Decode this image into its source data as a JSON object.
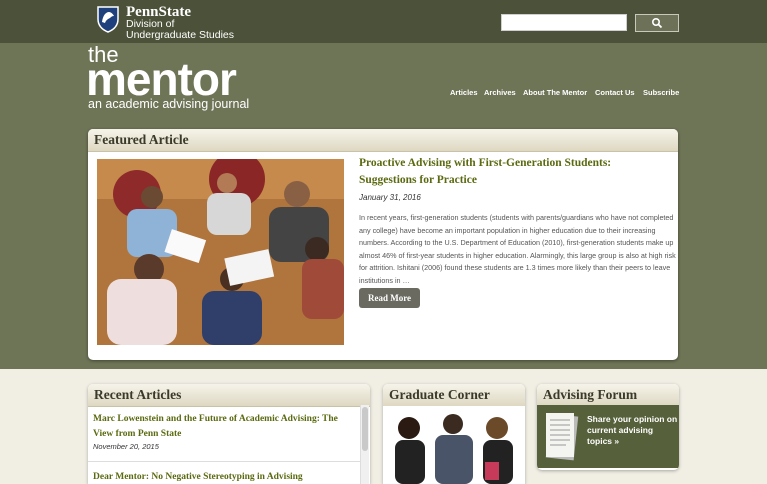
{
  "brand": {
    "university": "PennState",
    "division_line1": "Division of",
    "division_line2": "Undergraduate Studies"
  },
  "search": {
    "placeholder": "",
    "button_icon": "search-icon"
  },
  "logo": {
    "the": "the",
    "mentor": "mentor",
    "tagline": "an academic advising journal"
  },
  "nav": [
    "Articles",
    "Archives",
    "About The Mentor",
    "Contact Us",
    "Subscribe"
  ],
  "featured": {
    "header": "Featured Article",
    "title": "Proactive Advising with First-Generation Students: Suggestions for Practice",
    "date": "January 31, 2016",
    "body": "In recent years, first-generation students (students with parents/guardians who have not completed any college) have become an important population in higher education due to their increasing numbers. According to the U.S. Department of Education (2010), first-generation students make up almost 46% of first-year students in higher education. Alarmingly, this large group is also at high risk for attrition. Ishitani (2006) found these students are 1.3 times more likely than their peers to leave institutions in …",
    "read_more": "Read More"
  },
  "recent": {
    "header": "Recent Articles",
    "items": [
      {
        "title": "Marc Lowenstein and the Future of Academic Advising: The View from Penn State",
        "date": "November 20, 2015"
      },
      {
        "title": "Dear Mentor: No Negative Stereotyping in Advising"
      }
    ]
  },
  "graduate": {
    "header": "Graduate Corner"
  },
  "forum": {
    "header": "Advising Forum",
    "text": "Share your opinion on current advising topics »"
  },
  "colors": {
    "header_bg": "#6e7456",
    "topbar_bg": "#4c5239",
    "title_green": "#5b6a10",
    "page_bg": "#f1efe4"
  }
}
